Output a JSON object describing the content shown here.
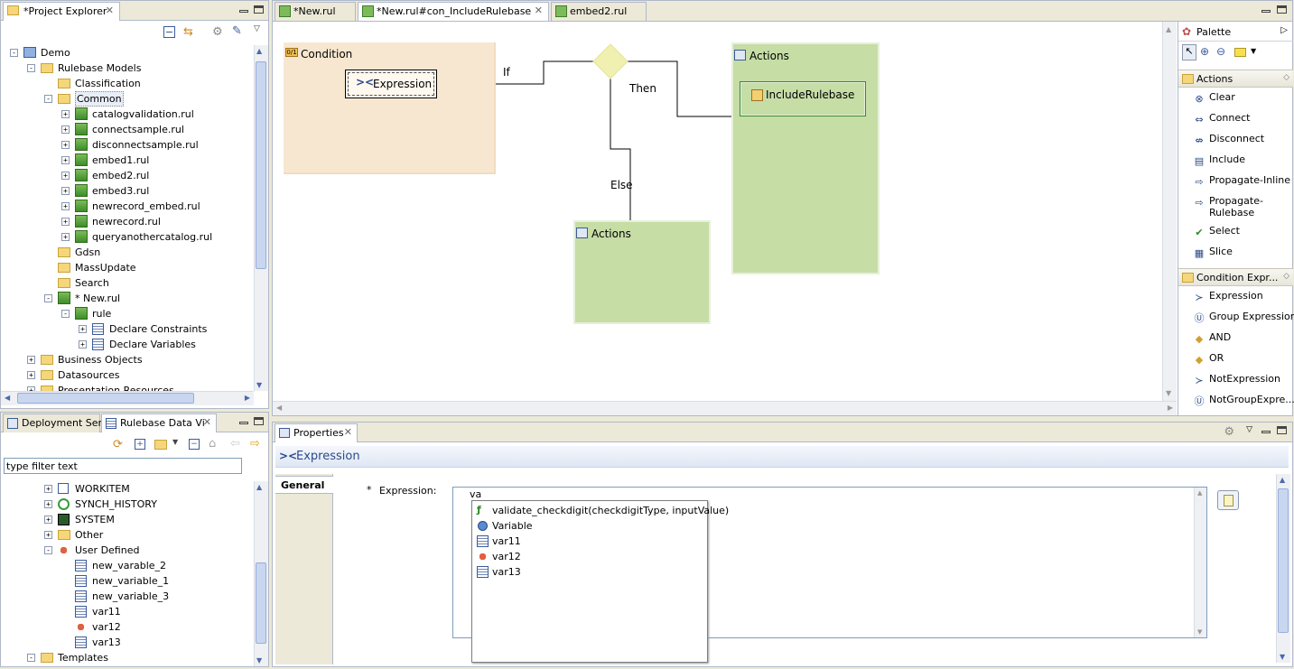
{
  "project_explorer": {
    "tab_label": "*Project Explorer",
    "tree": [
      {
        "label": "Demo",
        "level": 0,
        "icon": "project-icon",
        "expander": "-"
      },
      {
        "label": "Rulebase Models",
        "level": 1,
        "icon": "folder-icon",
        "expander": "-"
      },
      {
        "label": "Classification",
        "level": 2,
        "icon": "folder-icon",
        "expander": ""
      },
      {
        "label": "Common",
        "level": 2,
        "icon": "folder-icon",
        "expander": "-",
        "selected": true
      },
      {
        "label": "catalogvalidation.rul",
        "level": 3,
        "icon": "rule-file-icon",
        "expander": "+"
      },
      {
        "label": "connectsample.rul",
        "level": 3,
        "icon": "rule-file-icon",
        "expander": "+"
      },
      {
        "label": "disconnectsample.rul",
        "level": 3,
        "icon": "rule-file-icon",
        "expander": "+"
      },
      {
        "label": "embed1.rul",
        "level": 3,
        "icon": "rule-file-icon",
        "expander": "+"
      },
      {
        "label": "embed2.rul",
        "level": 3,
        "icon": "rule-file-icon",
        "expander": "+"
      },
      {
        "label": "embed3.rul",
        "level": 3,
        "icon": "rule-file-icon",
        "expander": "+"
      },
      {
        "label": "newrecord_embed.rul",
        "level": 3,
        "icon": "rule-file-icon",
        "expander": "+"
      },
      {
        "label": "newrecord.rul",
        "level": 3,
        "icon": "rule-file-icon",
        "expander": "+"
      },
      {
        "label": "queryanothercatalog.rul",
        "level": 3,
        "icon": "rule-file-icon",
        "expander": "+"
      },
      {
        "label": "Gdsn",
        "level": 2,
        "icon": "folder-icon",
        "expander": ""
      },
      {
        "label": "MassUpdate",
        "level": 2,
        "icon": "folder-icon",
        "expander": ""
      },
      {
        "label": "Search",
        "level": 2,
        "icon": "folder-icon",
        "expander": ""
      },
      {
        "label": "* New.rul",
        "level": 2,
        "icon": "rule-file-icon",
        "expander": "-"
      },
      {
        "label": "rule",
        "level": 3,
        "icon": "rule-icon",
        "expander": "-"
      },
      {
        "label": "Declare Constraints",
        "level": 4,
        "icon": "table-icon",
        "expander": "+"
      },
      {
        "label": "Declare Variables",
        "level": 4,
        "icon": "table-icon",
        "expander": "+"
      },
      {
        "label": "Business Objects",
        "level": 1,
        "icon": "folder-icon",
        "expander": "+"
      },
      {
        "label": "Datasources",
        "level": 1,
        "icon": "folder-icon",
        "expander": "+"
      },
      {
        "label": "Presentation Resources",
        "level": 1,
        "icon": "folder-icon",
        "expander": "+"
      }
    ]
  },
  "data_view": {
    "tabs": [
      {
        "label": "Deployment Serv"
      },
      {
        "label": "Rulebase Data Vi"
      }
    ],
    "filter_value": "type filter text",
    "tree": [
      {
        "label": "WORKITEM",
        "level": 0,
        "icon": "checkbox-icon",
        "expander": "+"
      },
      {
        "label": "SYNCH_HISTORY",
        "level": 0,
        "icon": "sync-icon",
        "expander": "+"
      },
      {
        "label": "SYSTEM",
        "level": 0,
        "icon": "system-icon",
        "expander": "+"
      },
      {
        "label": "Other",
        "level": 0,
        "icon": "folder-icon",
        "expander": "+"
      },
      {
        "label": "User Defined",
        "level": 0,
        "icon": "variable-icon",
        "expander": "-"
      },
      {
        "label": "new_varable_2",
        "level": 1,
        "icon": "table-icon",
        "expander": ""
      },
      {
        "label": "new_variable_1",
        "level": 1,
        "icon": "table-icon",
        "expander": ""
      },
      {
        "label": "new_variable_3",
        "level": 1,
        "icon": "table-icon",
        "expander": ""
      },
      {
        "label": "var11",
        "level": 1,
        "icon": "table-icon",
        "expander": ""
      },
      {
        "label": "var12",
        "level": 1,
        "icon": "variable-icon",
        "expander": ""
      },
      {
        "label": "var13",
        "level": 1,
        "icon": "table-icon",
        "expander": ""
      },
      {
        "label": "Templates",
        "level": -1,
        "icon": "folder-icon",
        "expander": "-"
      }
    ]
  },
  "editor": {
    "tabs": [
      {
        "label": "*New.rul"
      },
      {
        "label": "*New.rul#con_IncludeRulebase",
        "active": true
      },
      {
        "label": "embed2.rul"
      }
    ],
    "condition_title": "Condition",
    "expression_node": "Expression",
    "if_label": "If",
    "then_label": "Then",
    "else_label": "Else",
    "actions_then_title": "Actions",
    "actions_else_title": "Actions",
    "include_rulebase": "IncludeRulebase"
  },
  "palette": {
    "title": "Palette",
    "drawers": [
      {
        "title": "Actions",
        "items": [
          {
            "label": "Clear",
            "icon": "clear-icon"
          },
          {
            "label": "Connect",
            "icon": "connect-icon"
          },
          {
            "label": "Disconnect",
            "icon": "disconnect-icon"
          },
          {
            "label": "Include",
            "icon": "include-icon"
          },
          {
            "label": "Propagate-Inline",
            "icon": "propagate-icon"
          },
          {
            "label": "Propagate-",
            "label2": "Rulebase",
            "icon": "propagate-icon"
          },
          {
            "label": "Select",
            "icon": "checkmark-icon"
          },
          {
            "label": "Slice",
            "icon": "slice-icon"
          }
        ]
      },
      {
        "title": "Condition Expr...",
        "items": [
          {
            "label": "Expression",
            "icon": "expression-icon"
          },
          {
            "label": "Group Expression",
            "icon": "group-expression-icon"
          },
          {
            "label": "AND",
            "icon": "and-icon"
          },
          {
            "label": "OR",
            "icon": "or-icon"
          },
          {
            "label": "NotExpression",
            "icon": "not-expression-icon"
          },
          {
            "label": "NotGroupExpre...",
            "icon": "not-group-expression-icon"
          }
        ]
      }
    ]
  },
  "properties": {
    "tab_label": "Properties",
    "header": "Expression",
    "section_tab": "General",
    "field_required": "*",
    "field_label": "Expression:",
    "field_value": "va",
    "autocomplete": [
      {
        "label": "validate_checkdigit(checkdigitType, inputValue)",
        "icon": "function-icon"
      },
      {
        "label": "Variable",
        "icon": "variable-circle-icon"
      },
      {
        "label": "var11",
        "icon": "table-icon"
      },
      {
        "label": "var12",
        "icon": "variable-icon"
      },
      {
        "label": "var13",
        "icon": "table-icon"
      }
    ]
  },
  "colors": {
    "condition_bg": "#f8e7d0",
    "actions_bg": "#c6dda6",
    "diamond": "#f0f0b0",
    "header_blue": "#2a4a8a"
  }
}
